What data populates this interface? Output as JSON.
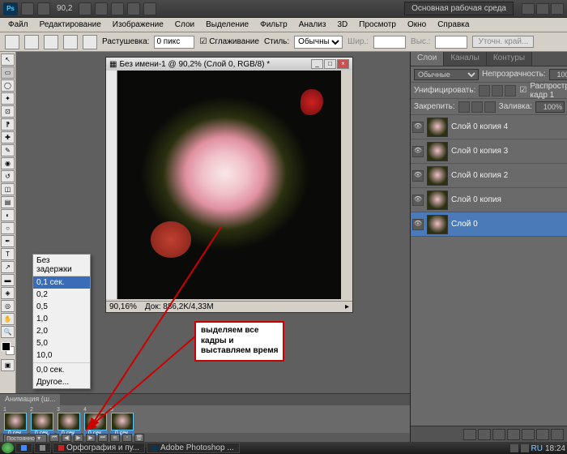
{
  "topbar": {
    "zoom": "90,2",
    "workspace": "Основная рабочая среда"
  },
  "menu": [
    "Файл",
    "Редактирование",
    "Изображение",
    "Слои",
    "Выделение",
    "Фильтр",
    "Анализ",
    "3D",
    "Просмотр",
    "Окно",
    "Справка"
  ],
  "options": {
    "feather_label": "Растушевка:",
    "feather_val": "0 пикс",
    "antialias": "Сглаживание",
    "style_label": "Стиль:",
    "style_val": "Обычный",
    "width_label": "Шир.:",
    "height_label": "Выс.:",
    "refine": "Уточн. край..."
  },
  "document": {
    "title": "Без имени-1 @ 90,2% (Слой 0, RGB/8) *",
    "zoom": "90,16%",
    "info": "Док: 886,2K/4,33M"
  },
  "panels": {
    "tabs": [
      "Слои",
      "Каналы",
      "Контуры"
    ],
    "blend": "Обычные",
    "opacity_label": "Непрозрачность:",
    "opacity": "100%",
    "unify_label": "Унифицировать:",
    "propagate": "Распространить кадр 1",
    "lock_label": "Закрепить:",
    "fill_label": "Заливка:",
    "fill": "100%",
    "layers": [
      {
        "name": "Слой 0 копия 4"
      },
      {
        "name": "Слой 0 копия 3"
      },
      {
        "name": "Слой 0 копия 2"
      },
      {
        "name": "Слой 0 копия"
      },
      {
        "name": "Слой 0"
      }
    ]
  },
  "animation": {
    "tab": "Анимация (ш...",
    "frames": [
      {
        "n": "1",
        "d": "0 сек."
      },
      {
        "n": "2",
        "d": "0 сек."
      },
      {
        "n": "3",
        "d": "0 сек."
      },
      {
        "n": "4",
        "d": "0 сек."
      },
      {
        "n": "5",
        "d": "0 сек."
      }
    ],
    "loop": "Постоянно"
  },
  "delay_menu": {
    "header": "Без задержки",
    "items": [
      "0,1 сек.",
      "0,2",
      "0,5",
      "1,0",
      "2,0",
      "5,0",
      "10,0"
    ],
    "sep_items": [
      "0,0 сек.",
      "Другое..."
    ]
  },
  "callout": {
    "l1": "выделяем все",
    "l2": "кадры и",
    "l3": "выставляем время"
  },
  "taskbar": {
    "app1": "Орфография и пу...",
    "app2": "Adobe Photoshop ...",
    "lang": "RU",
    "time": "18:24"
  }
}
